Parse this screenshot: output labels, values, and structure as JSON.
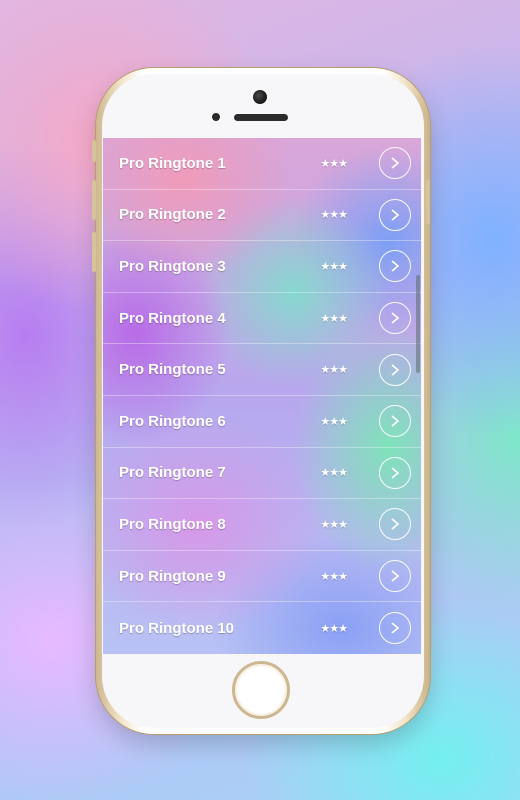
{
  "ringtones": {
    "items": [
      {
        "label": "Pro Ringtone 1",
        "rating": "★★★"
      },
      {
        "label": "Pro Ringtone 2",
        "rating": "★★★"
      },
      {
        "label": "Pro Ringtone 3",
        "rating": "★★★"
      },
      {
        "label": "Pro Ringtone 4",
        "rating": "★★★"
      },
      {
        "label": "Pro Ringtone 5",
        "rating": "★★★"
      },
      {
        "label": "Pro Ringtone 6",
        "rating": "★★★"
      },
      {
        "label": "Pro Ringtone 7",
        "rating": "★★★"
      },
      {
        "label": "Pro Ringtone 8",
        "rating": "★★★"
      },
      {
        "label": "Pro Ringtone 9",
        "rating": "★★★"
      },
      {
        "label": "Pro Ringtone 10",
        "rating": "★★★"
      }
    ],
    "action_icon": "chevron-right-icon"
  },
  "colors": {
    "text": "#ffffff",
    "phone_frame": "#cdb791",
    "phone_face": "#f7f7f9"
  }
}
